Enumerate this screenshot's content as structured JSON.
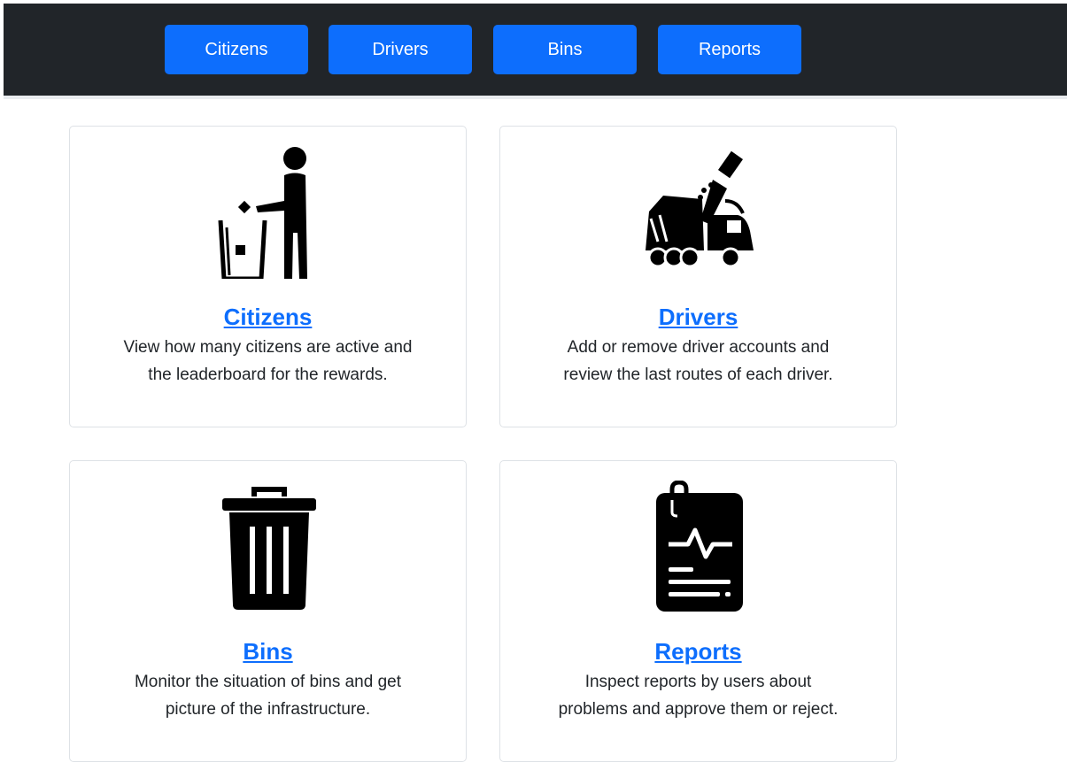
{
  "nav": {
    "citizens_label": "Citizens",
    "drivers_label": "Drivers",
    "bins_label": "Bins",
    "reports_label": "Reports"
  },
  "cards": {
    "citizens": {
      "title": "Citizens",
      "line1": "View how many citizens are active and",
      "line2": "the leaderboard for the rewards.",
      "icon": "person-trash-icon"
    },
    "drivers": {
      "title": "Drivers",
      "line1": "Add or remove driver accounts and",
      "line2": "review the last routes of each driver.",
      "icon": "garbage-truck-icon"
    },
    "bins": {
      "title": "Bins",
      "line1": "Monitor the situation of bins and get",
      "line2": "picture of the infrastructure.",
      "icon": "trash-bin-icon"
    },
    "reports": {
      "title": "Reports",
      "line1": "Inspect reports by users about",
      "line2": "problems and approve them or reject.",
      "icon": "report-clipboard-icon"
    }
  },
  "colors": {
    "navbar_bg": "#212529",
    "button_bg": "#0d6efd",
    "link": "#0d6efd",
    "text": "#212529"
  }
}
